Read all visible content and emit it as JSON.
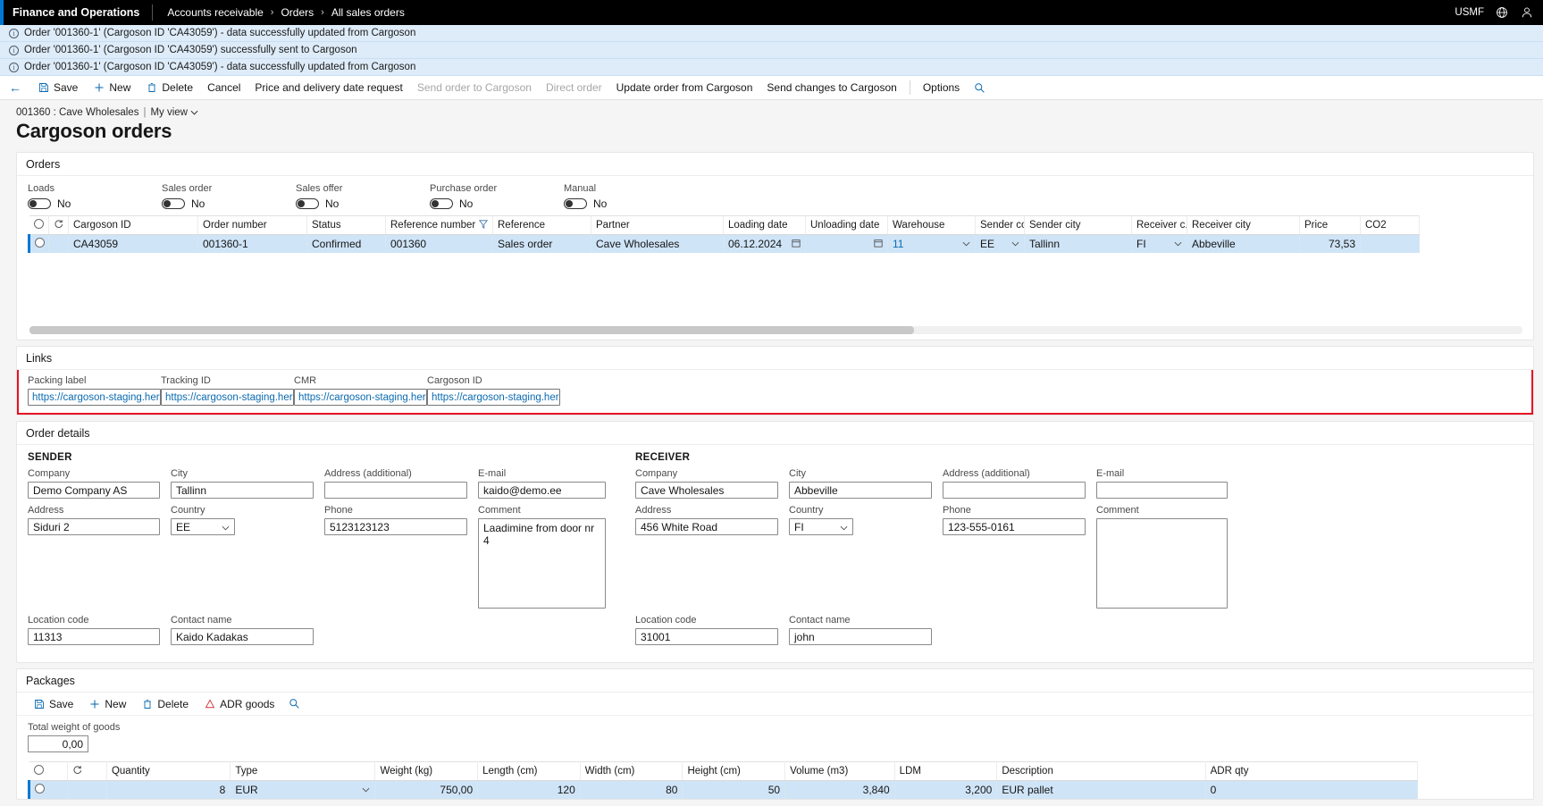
{
  "topbar": {
    "app_title": "Finance and Operations",
    "breadcrumb": [
      "Accounts receivable",
      "Orders",
      "All sales orders"
    ],
    "company": "USMF",
    "globe_icon": "globe-icon",
    "account_icon": "account-icon",
    "chevron": "›"
  },
  "notifications": [
    "Order '001360-1' (Cargoson ID 'CA43059') - data successfully updated from Cargoson",
    "Order '001360-1' (Cargoson ID 'CA43059') successfully sent to Cargoson",
    "Order '001360-1' (Cargoson ID 'CA43059') - data successfully updated from Cargoson"
  ],
  "toolbar": {
    "back": "←",
    "items": [
      {
        "label": "Save",
        "icon": "save-icon",
        "disabled": false
      },
      {
        "label": "New",
        "icon": "plus-icon",
        "disabled": false
      },
      {
        "label": "Delete",
        "icon": "trash-icon",
        "disabled": false
      },
      {
        "label": "Cancel",
        "icon": "",
        "disabled": false
      },
      {
        "label": "Price and delivery date request",
        "icon": "",
        "disabled": false
      },
      {
        "label": "Send order to Cargoson",
        "icon": "",
        "disabled": true
      },
      {
        "label": "Direct order",
        "icon": "",
        "disabled": true
      },
      {
        "label": "Update order from Cargoson",
        "icon": "",
        "disabled": false
      },
      {
        "label": "Send changes to Cargoson",
        "icon": "",
        "disabled": false
      },
      {
        "label": "Options",
        "icon": "",
        "disabled": false
      }
    ],
    "search_icon": "search-icon"
  },
  "page": {
    "caption": "001360 : Cave Wholesales",
    "separator": "|",
    "view": "My view",
    "view_chevron": "∨",
    "title": "Cargoson orders"
  },
  "orders_section": {
    "header": "Orders",
    "filters": [
      {
        "label": "Loads",
        "value": "No"
      },
      {
        "label": "Sales order",
        "value": "No"
      },
      {
        "label": "Sales offer",
        "value": "No"
      },
      {
        "label": "Purchase order",
        "value": "No"
      },
      {
        "label": "Manual",
        "value": "No"
      }
    ],
    "columns": [
      "Cargoson ID",
      "Order number",
      "Status",
      "Reference number",
      "Reference",
      "Partner",
      "Loading date",
      "Unloading date",
      "Warehouse",
      "Sender co...",
      "Sender city",
      "Receiver c...",
      "Receiver city",
      "Price",
      "CO2"
    ],
    "filtered_column": "Reference number",
    "row": {
      "cargoson_id": "CA43059",
      "order_number": "001360-1",
      "status": "Confirmed",
      "reference_number": "001360",
      "reference": "Sales order",
      "partner": "Cave Wholesales",
      "loading_date": "06.12.2024",
      "unloading_date": "",
      "warehouse": "11",
      "sender_country": "EE",
      "sender_city": "Tallinn",
      "receiver_country": "FI",
      "receiver_city": "Abbeville",
      "price": "73,53",
      "co2": ""
    }
  },
  "links_section": {
    "header": "Links",
    "highlight_color": "#e81123",
    "fields": [
      {
        "label": "Packing label",
        "value": "https://cargoson-staging.her..."
      },
      {
        "label": "Tracking ID",
        "value": "https://cargoson-staging.her..."
      },
      {
        "label": "CMR",
        "value": "https://cargoson-staging.her..."
      },
      {
        "label": "Cargoson ID",
        "value": "https://cargoson-staging.her..."
      }
    ]
  },
  "order_details": {
    "header": "Order details",
    "sender": {
      "title": "SENDER",
      "company_label": "Company",
      "company_value": "Demo Company AS",
      "city_label": "City",
      "city_value": "Tallinn",
      "address_additional_label": "Address (additional)",
      "address_additional_value": "",
      "email_label": "E-mail",
      "email_value": "kaido@demo.ee",
      "address_label": "Address",
      "address_value": "Siduri 2",
      "country_label": "Country",
      "country_value": "EE",
      "phone_label": "Phone",
      "phone_value": "5123123123",
      "comment_label": "Comment",
      "comment_value": "Laadimine from door nr 4",
      "location_code_label": "Location code",
      "location_code_value": "11313",
      "contact_name_label": "Contact name",
      "contact_name_value": "Kaido Kadakas"
    },
    "receiver": {
      "title": "RECEIVER",
      "company_label": "Company",
      "company_value": "Cave Wholesales",
      "city_label": "City",
      "city_value": "Abbeville",
      "address_additional_label": "Address (additional)",
      "address_additional_value": "",
      "email_label": "E-mail",
      "email_value": "",
      "address_label": "Address",
      "address_value": "456 White Road",
      "country_label": "Country",
      "country_value": "FI",
      "phone_label": "Phone",
      "phone_value": "123-555-0161",
      "comment_label": "Comment",
      "comment_value": "",
      "location_code_label": "Location code",
      "location_code_value": "31001",
      "contact_name_label": "Contact name",
      "contact_name_value": "john"
    }
  },
  "packages_section": {
    "header": "Packages",
    "toolbar": [
      {
        "label": "Save",
        "icon": "save-icon"
      },
      {
        "label": "New",
        "icon": "plus-icon"
      },
      {
        "label": "Delete",
        "icon": "trash-icon"
      },
      {
        "label": "ADR goods",
        "icon": "warning-icon"
      }
    ],
    "search_icon": "search-icon",
    "total_weight_label": "Total weight of goods",
    "total_weight_value": "0,00",
    "columns": [
      "Quantity",
      "Type",
      "Weight (kg)",
      "Length (cm)",
      "Width (cm)",
      "Height (cm)",
      "Volume (m3)",
      "LDM",
      "Description",
      "ADR qty"
    ],
    "row": {
      "quantity": "8",
      "type": "EUR",
      "weight": "750,00",
      "length": "120",
      "width": "80",
      "height": "50",
      "volume": "3,840",
      "ldm": "3,200",
      "description": "EUR pallet",
      "adr_qty": "0"
    }
  }
}
